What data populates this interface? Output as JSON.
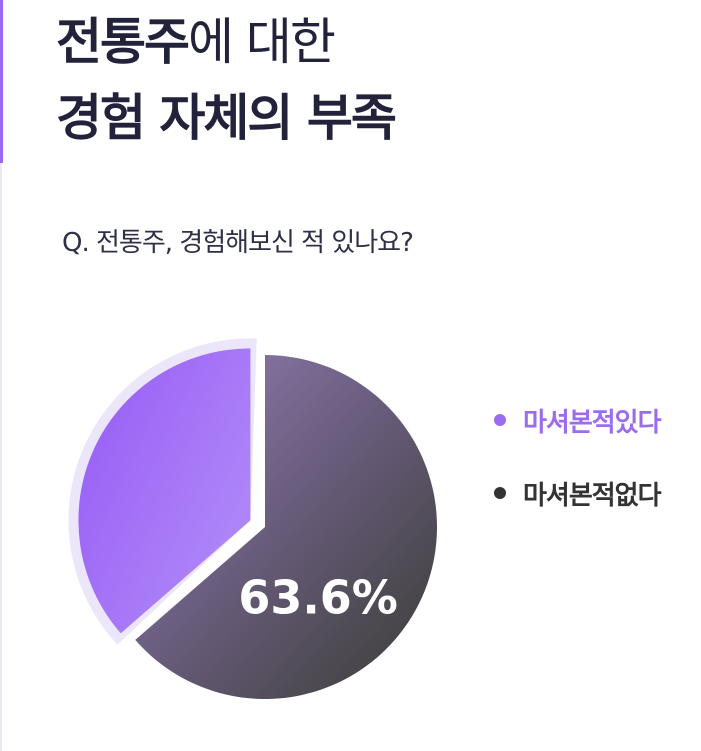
{
  "title": {
    "line1_bold": "전통주",
    "line1_rest": "에 대한",
    "line2": "경험 자체의 부족"
  },
  "question": "Q. 전통주, 경험해보신 적 있나요?",
  "chart_data": {
    "type": "pie",
    "slices": [
      {
        "label": "마셔본적있다",
        "value": 36.4,
        "color": "#9b6cf0"
      },
      {
        "label": "마셔본적없다",
        "value": 63.6,
        "color": "#4a4a4a",
        "data_label": "63.6%"
      }
    ]
  },
  "legend": [
    {
      "label": "마셔본적있다",
      "color": "#9b6cf0"
    },
    {
      "label": "마셔본적없다",
      "color": "#333333"
    }
  ]
}
